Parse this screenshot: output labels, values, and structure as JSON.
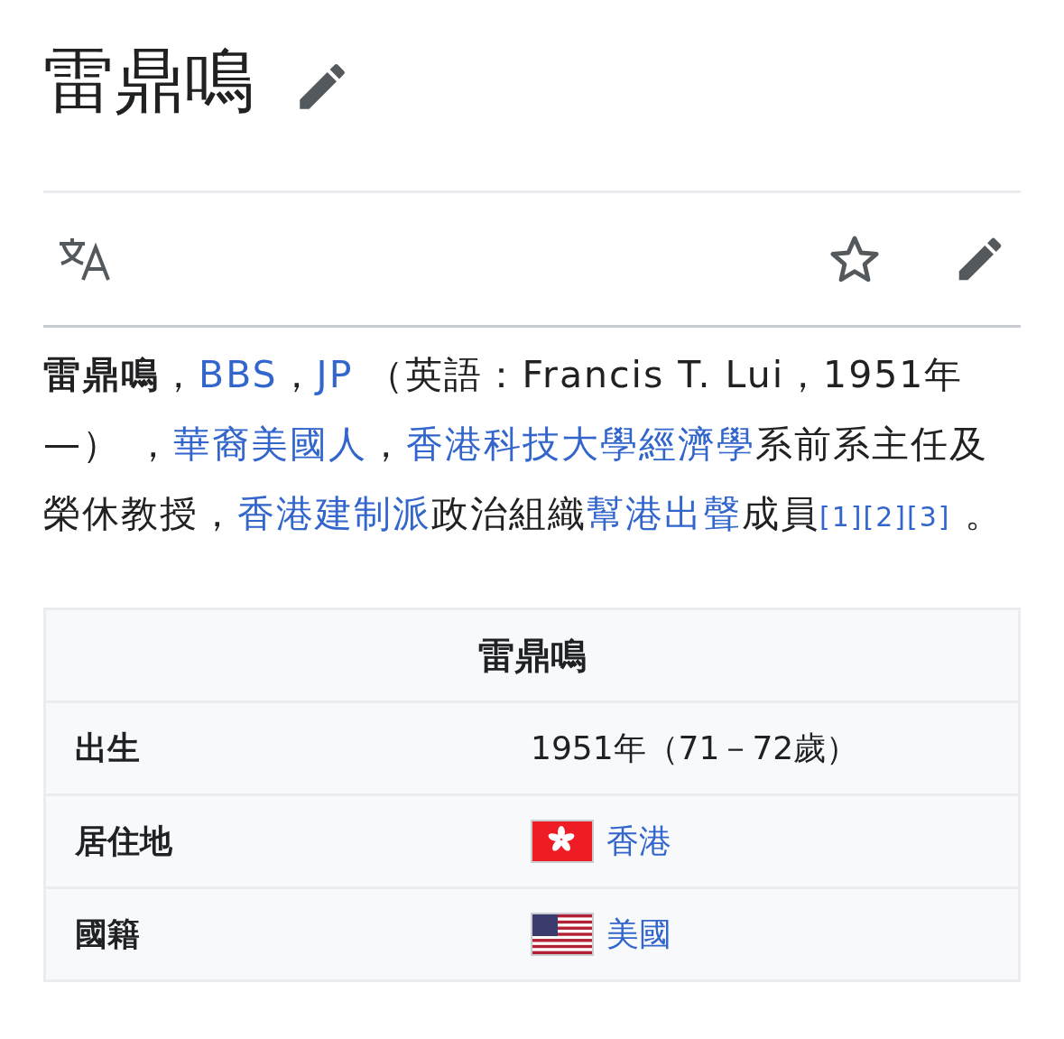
{
  "title": "雷鼎鳴",
  "intro": [
    {
      "kind": "bold",
      "text": "雷鼎鳴"
    },
    {
      "kind": "text",
      "text": "，"
    },
    {
      "kind": "link",
      "text": "BBS"
    },
    {
      "kind": "text",
      "text": "，"
    },
    {
      "kind": "link",
      "text": "JP"
    },
    {
      "kind": "text",
      "text": " （英語：Francis T. Lui，1951年—） ，"
    },
    {
      "kind": "link",
      "text": "華裔美國人"
    },
    {
      "kind": "text",
      "text": "，"
    },
    {
      "kind": "link",
      "text": "香港科技大學經濟學"
    },
    {
      "kind": "text",
      "text": "系前系主任及榮休教授，"
    },
    {
      "kind": "link",
      "text": "香港建制派"
    },
    {
      "kind": "text",
      "text": "政治組織"
    },
    {
      "kind": "link",
      "text": "幫港出聲"
    },
    {
      "kind": "text",
      "text": "成員"
    },
    {
      "kind": "ref",
      "text": "[1]"
    },
    {
      "kind": "ref",
      "text": "[2]"
    },
    {
      "kind": "ref",
      "text": "[3]"
    },
    {
      "kind": "text",
      "text": " 。"
    }
  ],
  "infobox": {
    "title": "雷鼎鳴",
    "rows": [
      {
        "label": "出生",
        "value": "1951年（71－72歲）",
        "kind": "text"
      },
      {
        "label": "居住地",
        "value": "香港",
        "kind": "link",
        "flag": {
          "kind": "hk"
        }
      },
      {
        "label": "國籍",
        "value": "美國",
        "kind": "link",
        "flag": {
          "kind": "us"
        }
      }
    ]
  }
}
